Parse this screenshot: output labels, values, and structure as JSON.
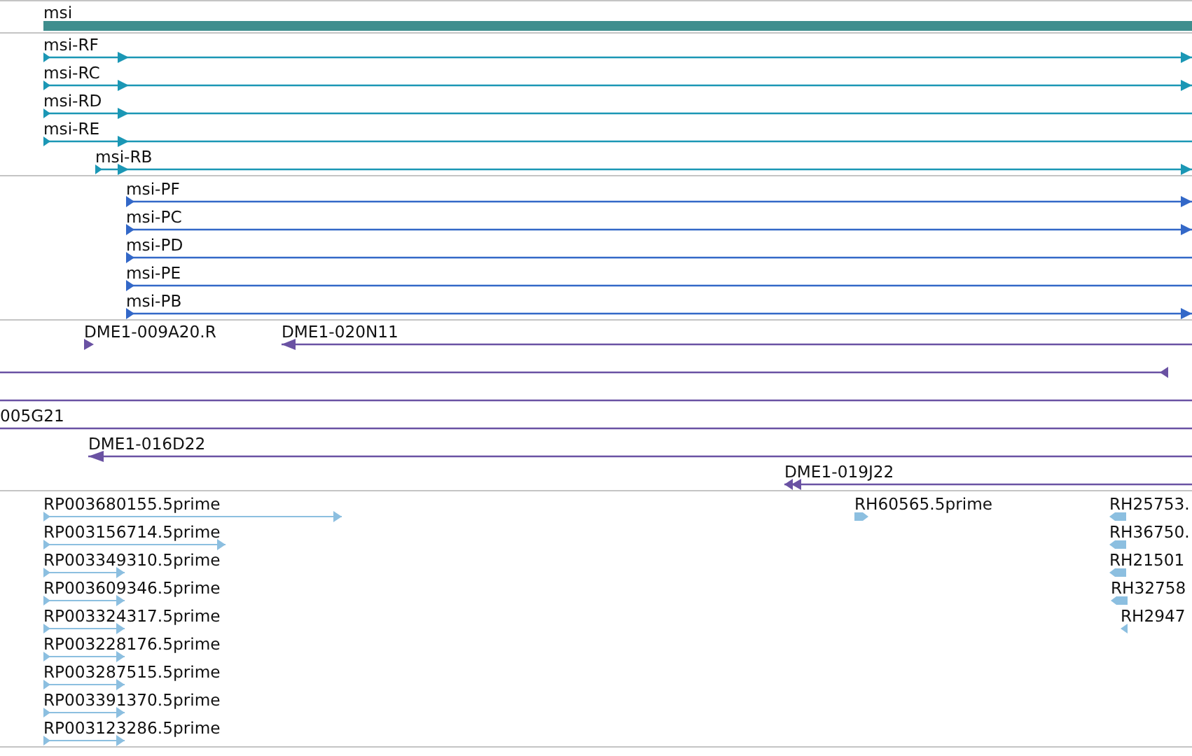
{
  "tracks": [
    {
      "kind": "gene",
      "rows": [
        [
          {
            "label": "msi"
          }
        ]
      ]
    },
    {
      "kind": "transcript",
      "rows": [
        [
          {
            "label": "msi-RF",
            "reverse": false
          }
        ],
        [
          {
            "label": "msi-RC",
            "reverse": false
          }
        ],
        [
          {
            "label": "msi-RD",
            "reverse": false
          }
        ],
        [
          {
            "label": "msi-RE",
            "reverse": false
          }
        ],
        [
          {
            "label": "msi-RB",
            "reverse": false
          }
        ]
      ]
    },
    {
      "kind": "protein",
      "rows": [
        [
          {
            "label": "msi-PF",
            "reverse": false
          }
        ],
        [
          {
            "label": "msi-PC",
            "reverse": false
          }
        ],
        [
          {
            "label": "msi-PD",
            "reverse": false
          }
        ],
        [
          {
            "label": "msi-PE",
            "reverse": false
          }
        ],
        [
          {
            "label": "msi-PB",
            "reverse": false
          }
        ]
      ]
    },
    {
      "kind": "clone",
      "rows": [
        [
          {
            "label": "DME1-009A20.R",
            "reverse": false
          },
          {
            "label": "DME1-020N11",
            "reverse": true
          }
        ],
        [
          {
            "reverse": true
          }
        ],
        [
          {}
        ],
        [
          {
            "label": "005G21"
          }
        ],
        [
          {
            "label": "DME1-016D22",
            "reverse": true
          }
        ],
        [
          {
            "label": "DME1-019J22",
            "reverse": true
          }
        ]
      ]
    },
    {
      "kind": "est",
      "rows": [
        [
          {
            "label": "RP003680155.5prime",
            "reverse": false
          },
          {
            "label": "RH60565.5prime",
            "reverse": false
          },
          {
            "label": "RH25753.",
            "reverse": true
          }
        ],
        [
          {
            "label": "RP003156714.5prime",
            "reverse": false
          },
          {
            "label": "RH36750.",
            "reverse": true
          }
        ],
        [
          {
            "label": "RP003349310.5prime",
            "reverse": false
          },
          {
            "label": "RH21501",
            "reverse": true
          }
        ],
        [
          {
            "label": "RP003609346.5prime",
            "reverse": false
          },
          {
            "label": "RH32758",
            "reverse": true
          }
        ],
        [
          {
            "label": "RP003324317.5prime",
            "reverse": false
          },
          {
            "label": "RH2947",
            "reverse": true
          }
        ],
        [
          {
            "label": "RP003228176.5prime",
            "reverse": false
          }
        ],
        [
          {
            "label": "RP003287515.5prime",
            "reverse": false
          }
        ],
        [
          {
            "label": "RP003391370.5prime",
            "reverse": false
          }
        ],
        [
          {
            "label": "RP003123286.5prime",
            "reverse": false
          }
        ]
      ]
    }
  ]
}
